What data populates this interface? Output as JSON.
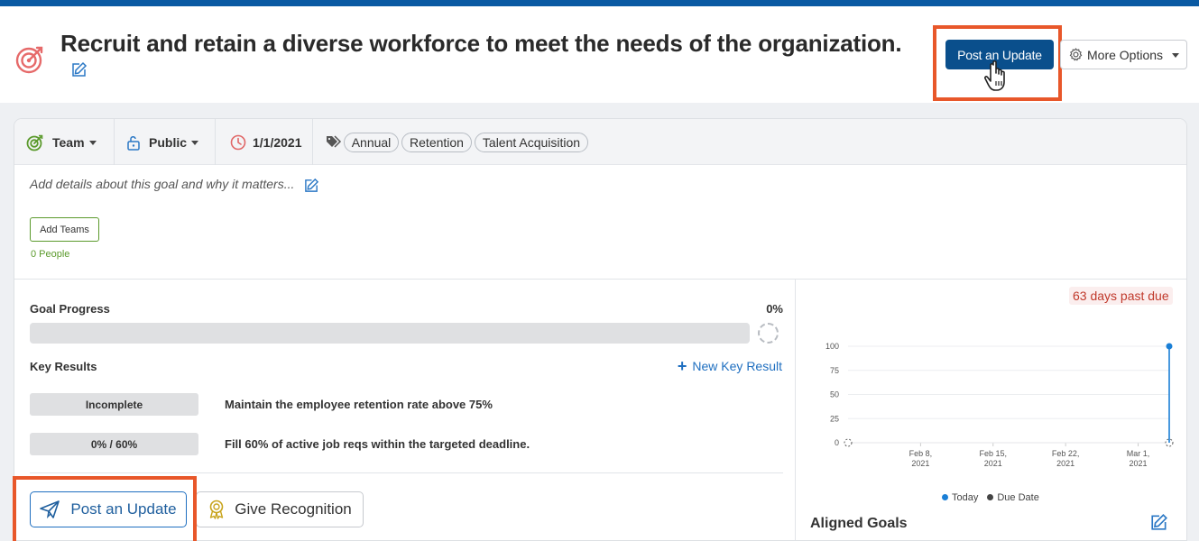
{
  "header": {
    "title": "Recruit and retain a diverse workforce to meet the needs of the organization.",
    "post_update_label": "Post an Update",
    "more_options_label": "More Options"
  },
  "meta": {
    "owner_type": "Team",
    "visibility": "Public",
    "date": "1/1/2021",
    "tags": [
      "Annual",
      "Retention",
      "Talent Acquisition"
    ]
  },
  "details": {
    "placeholder": "Add details about this goal and why it matters...",
    "add_teams_label": "Add Teams",
    "people_count": "0 People"
  },
  "progress": {
    "label": "Goal Progress",
    "percent_text": "0%",
    "fraction": 0
  },
  "key_results": {
    "label": "Key Results",
    "new_label": "New Key Result",
    "items": [
      {
        "status": "Incomplete",
        "title": "Maintain the employee retention rate above 75%"
      },
      {
        "status": "0% / 60%",
        "title": "Fill 60% of active job reqs within the targeted deadline."
      }
    ]
  },
  "actions": {
    "post_update_label": "Post an Update",
    "give_recognition_label": "Give Recognition"
  },
  "chart_panel": {
    "past_due": "63 days past due",
    "legend_today": "Today",
    "legend_due": "Due Date",
    "aligned_goals_label": "Aligned Goals"
  },
  "colors": {
    "brand_blue": "#0a5aa3",
    "highlight_orange": "#e8572a",
    "today_blue": "#1a7fd6",
    "team_green": "#5b9a2c",
    "past_due_red": "#c0392b"
  },
  "chart_data": {
    "type": "line",
    "yticks": [
      0,
      25,
      50,
      75,
      100
    ],
    "ylim": [
      0,
      100
    ],
    "x_start": "2021-02-01",
    "x_end": "2021-03-04",
    "xticks": [
      {
        "date": "2021-02-08",
        "label": [
          "Feb 8,",
          "2021"
        ]
      },
      {
        "date": "2021-02-15",
        "label": [
          "Feb 15,",
          "2021"
        ]
      },
      {
        "date": "2021-02-22",
        "label": [
          "Feb 22,",
          "2021"
        ]
      },
      {
        "date": "2021-03-01",
        "label": [
          "Mar 1,",
          "2021"
        ]
      }
    ],
    "series": [
      {
        "name": "Today",
        "points": [
          {
            "x": "2021-03-04",
            "y": 100
          }
        ]
      },
      {
        "name": "Due Date",
        "points": [
          {
            "x": "2021-02-01",
            "y": 0
          },
          {
            "x": "2021-03-04",
            "y": 0
          }
        ]
      }
    ]
  }
}
